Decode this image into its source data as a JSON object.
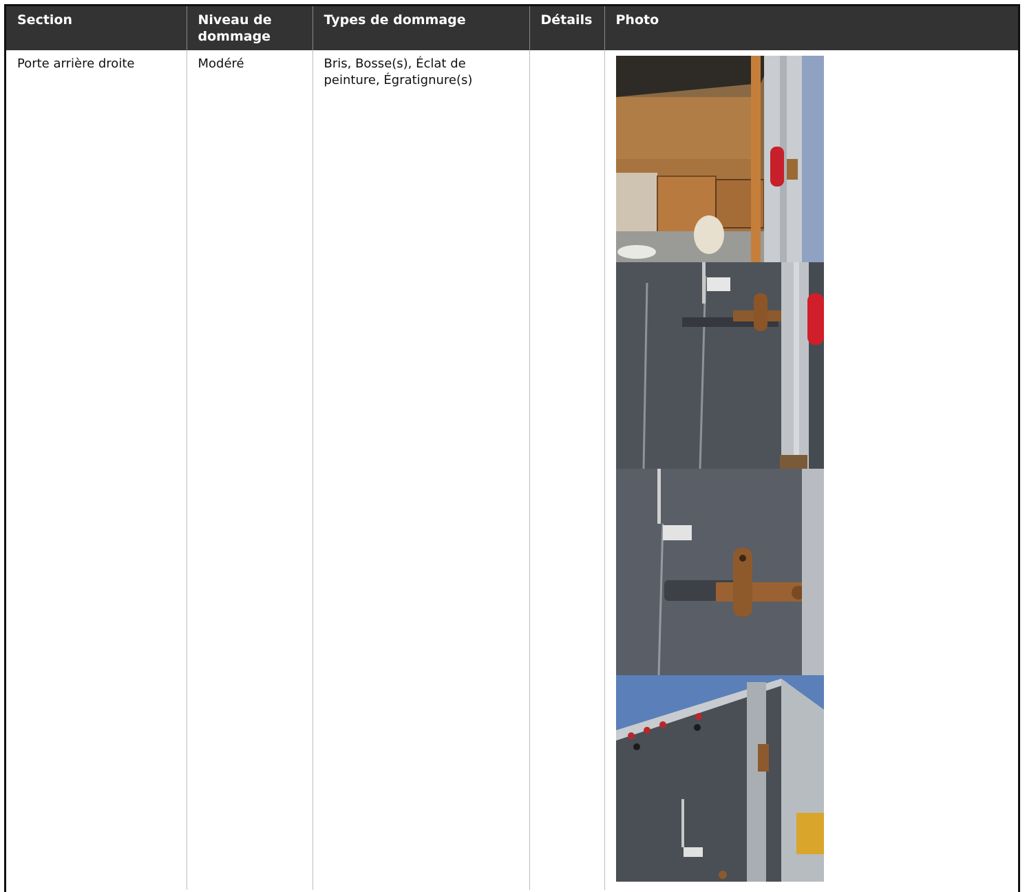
{
  "table": {
    "headers": {
      "section": "Section",
      "niveau": "Niveau de dommage",
      "types": "Types de dommage",
      "details": "Détails",
      "photo": "Photo"
    },
    "rows": [
      {
        "section": "Porte arrière droite",
        "niveau": "Modéré",
        "types": "Bris, Bosse(s), Éclat de peinture, Égratignure(s)",
        "details": "",
        "photos": [
          "truck-interior-photo",
          "door-panel-latch-photo",
          "latch-closeup-photo",
          "truck-rear-corner-photo"
        ]
      }
    ]
  }
}
